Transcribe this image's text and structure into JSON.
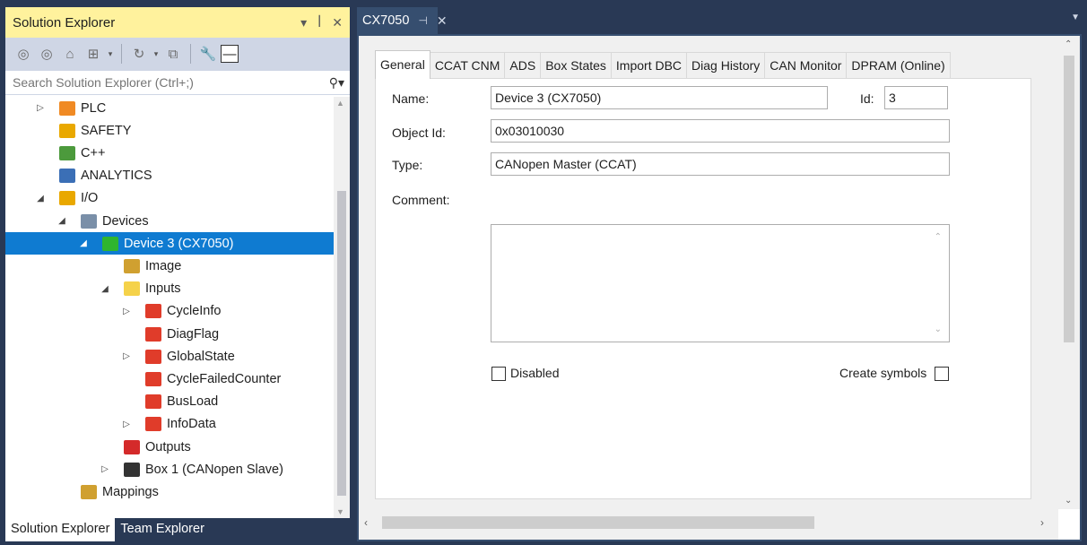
{
  "solution_explorer": {
    "title": "Solution Explorer",
    "title_buttons": [
      "▾",
      "ꟾ",
      "✕"
    ],
    "toolbar_icons": [
      "back-icon",
      "forward-icon",
      "home-icon",
      "sync-icon",
      "history-icon",
      "collapse-icon",
      "properties-icon",
      "pin-icon"
    ],
    "search_placeholder": "Search Solution Explorer (Ctrl+;)",
    "tree": [
      {
        "label": "PLC",
        "depth": 1,
        "expander": "▷",
        "icon": "plc-icon",
        "color": "#f08a24"
      },
      {
        "label": "SAFETY",
        "depth": 1,
        "expander": "",
        "icon": "safety-icon",
        "color": "#e9a800"
      },
      {
        "label": "C++",
        "depth": 1,
        "expander": "",
        "icon": "cpp-icon",
        "color": "#4c9a3c"
      },
      {
        "label": "ANALYTICS",
        "depth": 1,
        "expander": "",
        "icon": "analytics-icon",
        "color": "#3b6fb6"
      },
      {
        "label": "I/O",
        "depth": 1,
        "expander": "◢",
        "icon": "io-icon",
        "color": "#e9a800"
      },
      {
        "label": "Devices",
        "depth": 2,
        "expander": "◢",
        "icon": "devices-icon",
        "color": "#7a8fa8"
      },
      {
        "label": "Device 3 (CX7050)",
        "depth": 3,
        "expander": "◢",
        "icon": "device-icon",
        "color": "#2fb52f",
        "selected": true
      },
      {
        "label": "Image",
        "depth": 4,
        "expander": "",
        "icon": "image-icon",
        "color": "#d0a030"
      },
      {
        "label": "Inputs",
        "depth": 4,
        "expander": "◢",
        "icon": "inputs-folder-icon",
        "color": "#f5d24a"
      },
      {
        "label": "CycleInfo",
        "depth": 5,
        "expander": "▷",
        "icon": "variable-icon",
        "color": "#e03c2a"
      },
      {
        "label": "DiagFlag",
        "depth": 5,
        "expander": "",
        "icon": "variable-icon",
        "color": "#e03c2a"
      },
      {
        "label": "GlobalState",
        "depth": 5,
        "expander": "▷",
        "icon": "variable-icon",
        "color": "#e03c2a"
      },
      {
        "label": "CycleFailedCounter",
        "depth": 5,
        "expander": "",
        "icon": "variable-icon",
        "color": "#e03c2a"
      },
      {
        "label": "BusLoad",
        "depth": 5,
        "expander": "",
        "icon": "variable-icon",
        "color": "#e03c2a"
      },
      {
        "label": "InfoData",
        "depth": 5,
        "expander": "▷",
        "icon": "variable-icon",
        "color": "#e03c2a"
      },
      {
        "label": "Outputs",
        "depth": 4,
        "expander": "",
        "icon": "outputs-folder-icon",
        "color": "#d42a2a"
      },
      {
        "label": "Box 1 (CANopen Slave)",
        "depth": 4,
        "expander": "▷",
        "icon": "box-icon",
        "color": "#333333"
      },
      {
        "label": "Mappings",
        "depth": 2,
        "expander": "",
        "icon": "mappings-icon",
        "color": "#d0a030"
      }
    ],
    "bottom_tabs": [
      "Solution Explorer",
      "Team Explorer"
    ]
  },
  "document": {
    "tab_title": "CX7050",
    "prop_tabs": [
      "General",
      "CCAT CNM",
      "ADS",
      "Box States",
      "Import DBC",
      "Diag History",
      "CAN Monitor",
      "DPRAM (Online)"
    ],
    "active_tab": "General",
    "general": {
      "name_label": "Name:",
      "name_value": "Device 3 (CX7050)",
      "id_label": "Id:",
      "id_value": "3",
      "object_id_label": "Object Id:",
      "object_id_value": "0x03010030",
      "type_label": "Type:",
      "type_value": "CANopen Master (CCAT)",
      "comment_label": "Comment:",
      "comment_value": "",
      "disabled_label": "Disabled",
      "create_symbols_label": "Create symbols"
    }
  },
  "colors": {
    "chrome": "#293955",
    "tab_active": "#364e6f",
    "title_highlight": "#fff29d",
    "selection": "#0f7bd1"
  }
}
